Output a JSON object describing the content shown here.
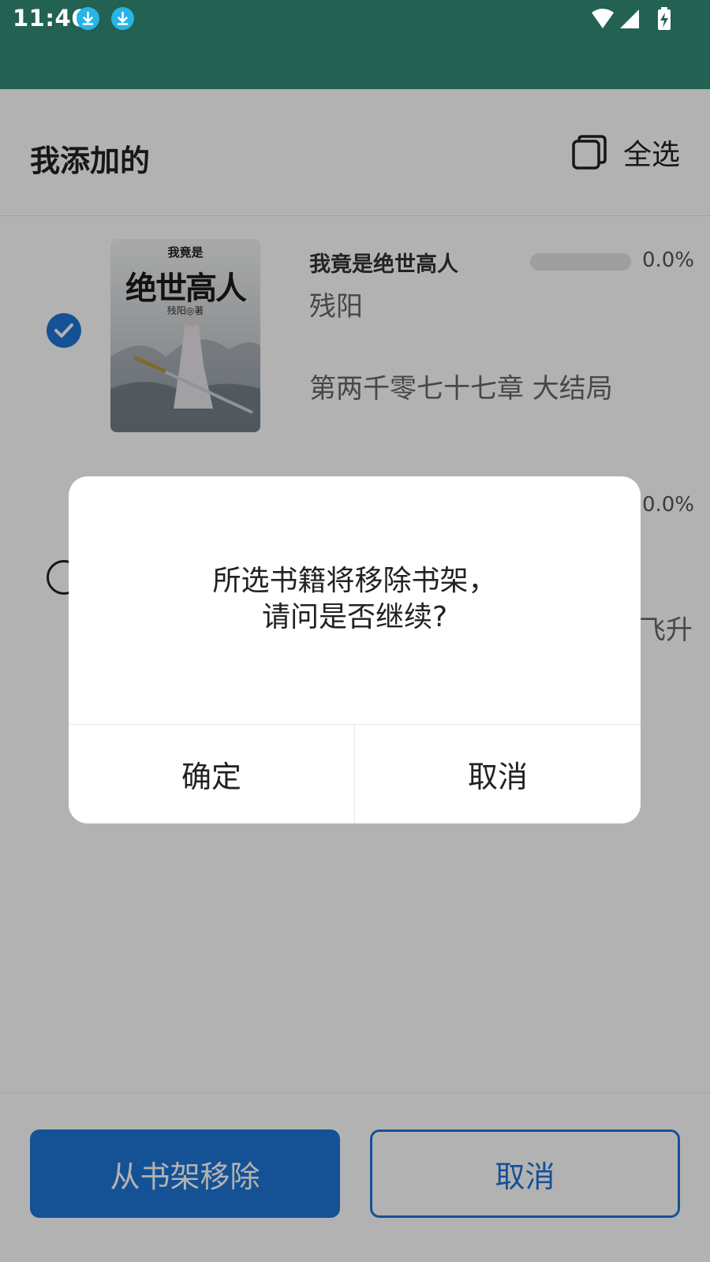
{
  "status_bar": {
    "time": "11:46",
    "icons": [
      "download-icon",
      "download-icon",
      "wifi-icon",
      "signal-icon",
      "battery-charging-icon"
    ]
  },
  "header": {
    "title": "我添加的",
    "select_all_label": "全选"
  },
  "books": [
    {
      "title": "我竟是绝世高人",
      "author": "残阳",
      "latest_chapter": "第两千零七十七章 大结局",
      "progress": 0.0,
      "progress_text": "0.0%",
      "selected": true,
      "cover_text": {
        "top": "我竟是",
        "main": "绝世高人",
        "byline": "残阳◎著"
      }
    },
    {
      "title": "",
      "author": "",
      "latest_chapter_fragment": "飞升",
      "progress": 0.0,
      "progress_text": "0.0%",
      "selected": false
    }
  ],
  "bottom_actions": {
    "remove_label": "从书架移除",
    "cancel_label": "取消"
  },
  "dialog": {
    "message_line1": "所选书籍将移除书架，",
    "message_line2": "请问是否继续?",
    "confirm_label": "确定",
    "cancel_label": "取消"
  },
  "colors": {
    "status_bar": "#236152",
    "accent": "#1f74d6",
    "download_badge": "#27b4e6"
  }
}
